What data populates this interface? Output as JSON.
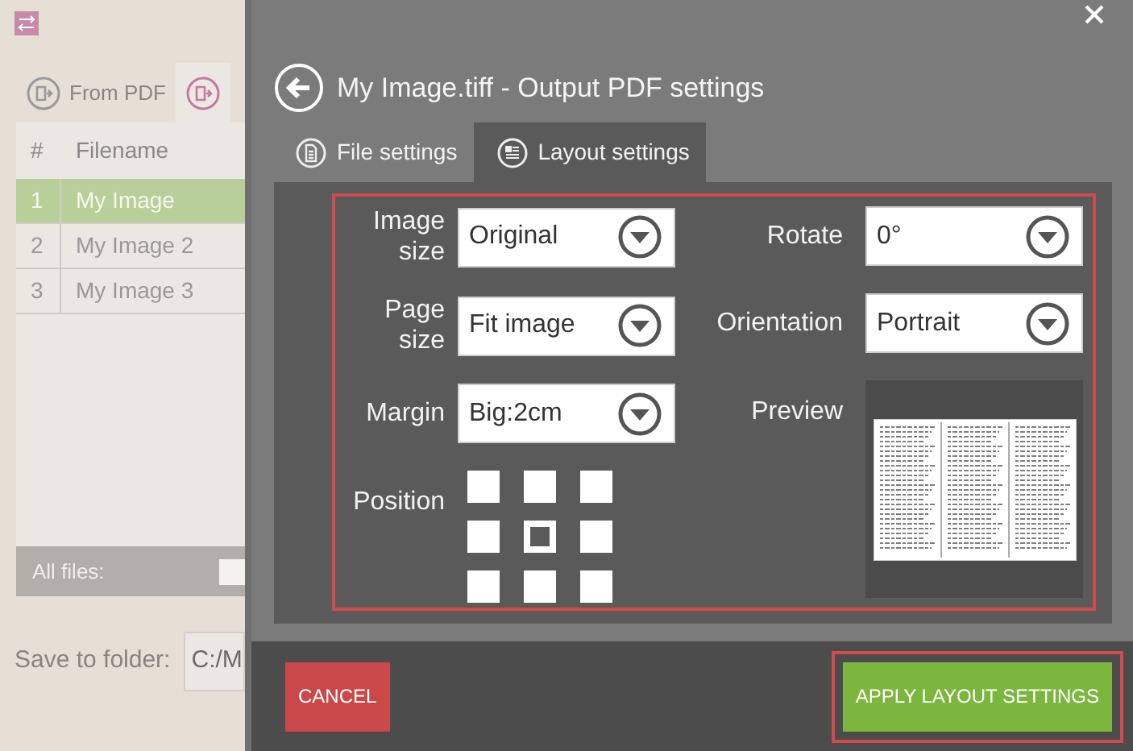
{
  "app": {
    "tabs": [
      {
        "label": "From PDF",
        "selected": false
      },
      {
        "selected": true
      }
    ],
    "table": {
      "columns": [
        "#",
        "Filename"
      ],
      "rows": [
        {
          "cells": [
            "1",
            "My Image"
          ],
          "selected": true
        },
        {
          "cells": [
            "2",
            "My Image 2"
          ],
          "selected": false
        },
        {
          "cells": [
            "3",
            "My Image 3"
          ],
          "selected": false
        }
      ]
    },
    "all_files": {
      "label": "All files:",
      "checked": false
    },
    "save_to_folder": {
      "label": "Save to folder:",
      "value": "C:/M"
    }
  },
  "dialog": {
    "title": "My Image.tiff - Output PDF settings",
    "tabs": [
      {
        "label": "File settings",
        "selected": false
      },
      {
        "label": "Layout settings",
        "selected": true
      }
    ],
    "left_fields": [
      {
        "label": "Image size",
        "value": "Original"
      },
      {
        "label": "Page size",
        "value": "Fit image"
      },
      {
        "label": "Margin",
        "value": "Big:2cm"
      }
    ],
    "right_fields": [
      {
        "label": "Rotate",
        "value": "0°"
      },
      {
        "label": "Orientation",
        "value": "Portrait"
      }
    ],
    "preview": {
      "label": "Preview"
    },
    "position": {
      "label": "Position",
      "cells": [
        {
          "selected": false
        },
        {
          "selected": false
        },
        {
          "selected": false
        },
        {
          "selected": false
        },
        {
          "selected": true
        },
        {
          "selected": false
        },
        {
          "selected": false
        },
        {
          "selected": false
        },
        {
          "selected": false
        }
      ]
    },
    "buttons": [
      {
        "label": "CANCEL",
        "kind": "cancel",
        "highlighted": false
      },
      {
        "label": "APPLY LAYOUT SETTINGS",
        "kind": "apply",
        "highlighted": true
      }
    ]
  }
}
